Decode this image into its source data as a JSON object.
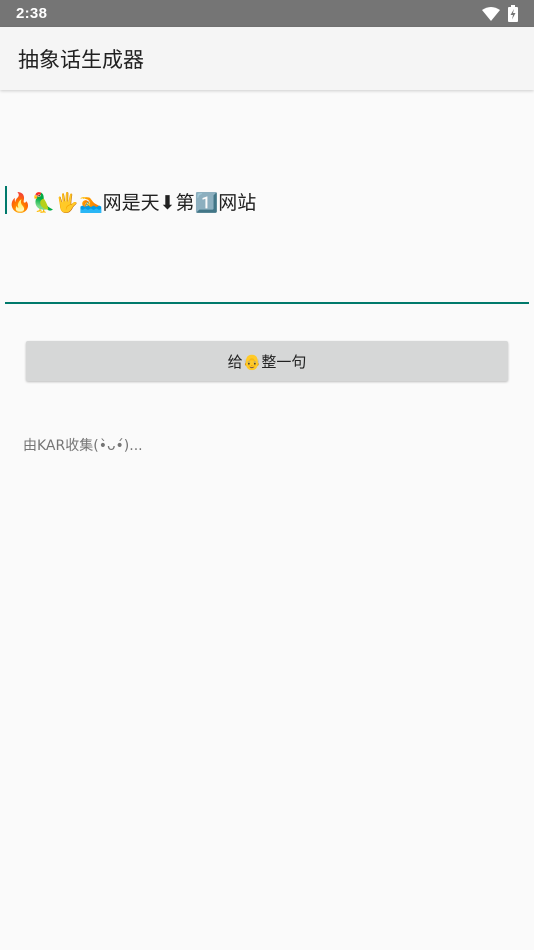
{
  "status_bar": {
    "time": "2:38",
    "icons": [
      "wifi-icon",
      "battery-charging-icon"
    ]
  },
  "app_bar": {
    "title": "抽象话生成器"
  },
  "input": {
    "value": "🔥🦜🖐🏊网是天⬇第1️⃣网站",
    "accent_color": "#00796b"
  },
  "button": {
    "label": "给👴整一句"
  },
  "footer": {
    "credit": "由KAR收集(•̀ᴗ•́)..."
  },
  "colors": {
    "status_bar": "#757575",
    "app_bar": "#f5f5f5",
    "background": "#fafafa",
    "button": "#d6d7d7"
  }
}
